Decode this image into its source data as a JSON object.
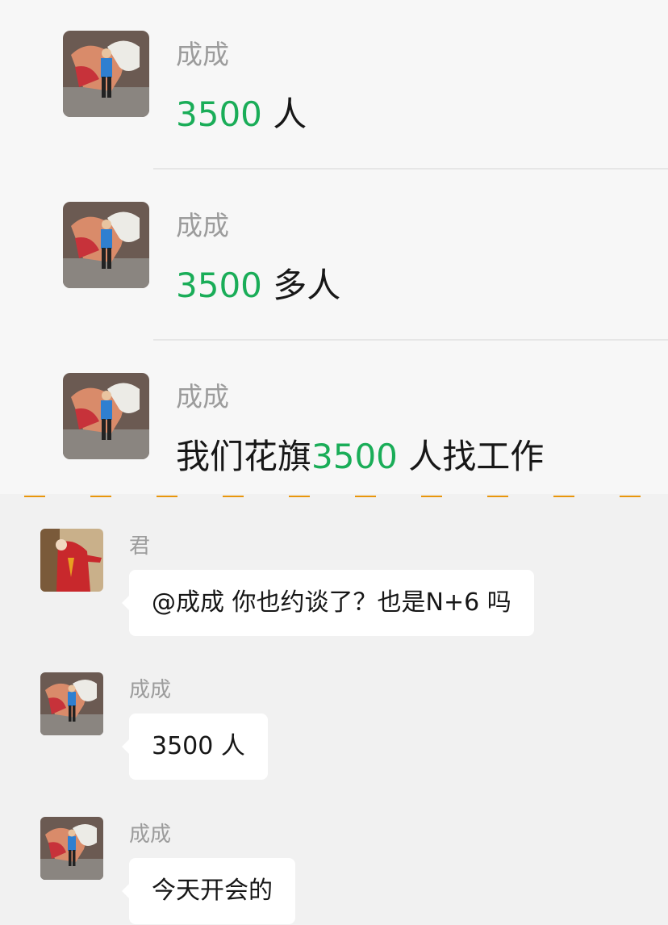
{
  "top_messages": [
    {
      "sender": "成成",
      "parts": [
        {
          "text": "3500",
          "hl": true
        },
        {
          "text": " 人",
          "hl": false
        }
      ]
    },
    {
      "sender": "成成",
      "parts": [
        {
          "text": "3500",
          "hl": true
        },
        {
          "text": " 多人",
          "hl": false
        }
      ]
    },
    {
      "sender": "成成",
      "parts": [
        {
          "text": "我们花旗",
          "hl": false
        },
        {
          "text": "3500",
          "hl": true
        },
        {
          "text": " 人找工作",
          "hl": false
        }
      ]
    }
  ],
  "chat_messages": [
    {
      "sender": "君",
      "text": "@成成 你也约谈了？也是N+6 吗",
      "avatar": "red-suit-avatar"
    },
    {
      "sender": "成成",
      "text": "3500 人",
      "avatar": "boy-avatar"
    },
    {
      "sender": "成成",
      "text": "今天开会的",
      "avatar": "boy-avatar"
    }
  ],
  "colors": {
    "highlight": "#1aad58",
    "divider": "#e8960c",
    "bubble": "#ffffff",
    "name": "#9c9c9c"
  }
}
